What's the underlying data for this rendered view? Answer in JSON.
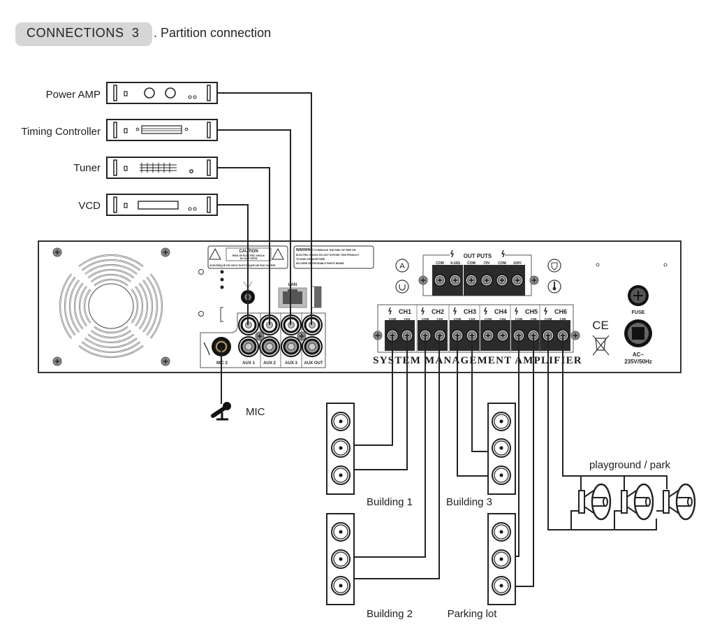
{
  "header": {
    "section_label": "CONNECTIONS",
    "section_number": "3",
    "section_title": ". Partition connection"
  },
  "sources": [
    {
      "id": "power-amp",
      "label": "Power AMP",
      "connects_to": "AUX OUT"
    },
    {
      "id": "timing-controller",
      "label": "Timing Controller",
      "connects_to": "AUX 3"
    },
    {
      "id": "tuner",
      "label": "Tuner",
      "connects_to": "AUX 2"
    },
    {
      "id": "vcd",
      "label": "VCD",
      "connects_to": "AUX 1"
    }
  ],
  "panel": {
    "caution": {
      "title": "CAUTION",
      "line1": "RISK OF ELECTRIC SHOCK",
      "line2": "DO NOT OPEN",
      "avis": "AVIS:RISQUE DE CHOC ELECTRIQUE-NE PAS OUVRIR"
    },
    "warning": {
      "title": "WARNING",
      "line1": "TO REDUCE THE RISK OF FIRE OR",
      "line2": "ELECTRIC SHOCK DO NOT EXPOSE THIS PRODUCT",
      "line3": "TO RAIN OR MOISTURE.",
      "line4": "NO USER SERVICEABLE PARTS INSIDE"
    },
    "lan_label": "LAN",
    "mic_label": "MIC 2",
    "aux_labels": [
      "AUX 1",
      "AUX 2",
      "AUX 3",
      "AUX OUT"
    ],
    "outputs": {
      "title": "OUT PUTS",
      "terminals": [
        "COM",
        "4-16Ω",
        "COM",
        "70V",
        "COM",
        "100V"
      ]
    },
    "channels": [
      {
        "name": "CH1",
        "terms": [
          "COM",
          "CH1"
        ]
      },
      {
        "name": "CH2",
        "terms": [
          "COM",
          "CH2"
        ]
      },
      {
        "name": "CH3",
        "terms": [
          "COM",
          "CH3"
        ]
      },
      {
        "name": "CH4",
        "terms": [
          "COM",
          "CH4"
        ]
      },
      {
        "name": "CH5",
        "terms": [
          "COM",
          "CH5"
        ]
      },
      {
        "name": "CH6",
        "terms": [
          "COM",
          "CH6"
        ]
      }
    ],
    "model_text": "SYSTEM MANAGEMENT AMPLIFIER",
    "fuse_label": "FUSE",
    "ac_label_1": "AC~",
    "ac_label_2": "235V/50Hz",
    "ce_mark": "CE",
    "icons": [
      "fan-grille-icon",
      "antenna-icon",
      "lan-port-icon",
      "ground-icon",
      "power-icon",
      "shield-icon",
      "thermometer-icon",
      "weee-bin-icon"
    ]
  },
  "mic": {
    "label": "MIC"
  },
  "zones": [
    {
      "label": "Building 1",
      "channel": "CH1"
    },
    {
      "label": "Building 2",
      "channel": "CH2"
    },
    {
      "label": "Building 3",
      "channel": "CH3"
    },
    {
      "label": "Parking lot",
      "channel": "CH5"
    },
    {
      "label": "playground / park",
      "channel": "CH6"
    }
  ]
}
